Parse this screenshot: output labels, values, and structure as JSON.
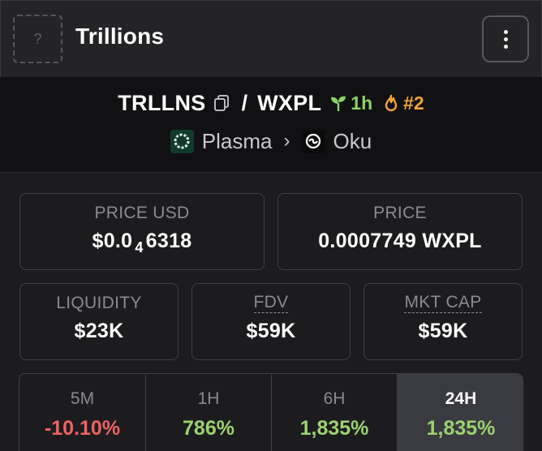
{
  "header": {
    "logo_placeholder": "?",
    "title": "Trillions",
    "menu_icon": "vertical-ellipsis-icon"
  },
  "pair": {
    "base": "TRLLNS",
    "copy_icon": "copy-icon",
    "separator": "/",
    "quote": "WXPL",
    "age_icon": "sprout-icon",
    "age": "1h",
    "rank_icon": "flame-icon",
    "rank": "#2",
    "chain": "Plasma",
    "chain_icon": "plasma-logo-icon",
    "chevron": "›",
    "dex": "Oku",
    "dex_icon": "oku-logo-icon"
  },
  "stats": {
    "price_usd": {
      "label": "PRICE USD",
      "prefix": "$0.0",
      "subscript": "4",
      "suffix": "6318"
    },
    "price": {
      "label": "PRICE",
      "value": "0.0007749 WXPL"
    },
    "liquidity": {
      "label": "LIQUIDITY",
      "value": "$23K"
    },
    "fdv": {
      "label": "FDV",
      "value": "$59K"
    },
    "mkt_cap": {
      "label": "MKT CAP",
      "value": "$59K"
    }
  },
  "timeframes": [
    {
      "label": "5M",
      "value": "-10.10%"
    },
    {
      "label": "1H",
      "value": "786%"
    },
    {
      "label": "6H",
      "value": "1,835%"
    },
    {
      "label": "24H",
      "value": "1,835%"
    }
  ],
  "colors": {
    "negative": "#ef6262",
    "positive": "#9bd26f",
    "age_green": "#8bd16b",
    "rank_orange": "#f2a33a"
  }
}
